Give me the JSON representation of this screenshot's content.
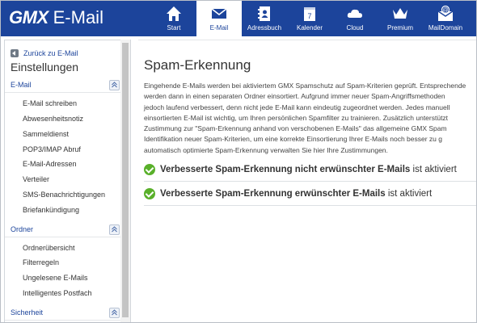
{
  "brand": {
    "logo": "GMX",
    "product": "E-Mail"
  },
  "nav": [
    {
      "label": "Start",
      "icon": "home-icon",
      "active": false
    },
    {
      "label": "E-Mail",
      "icon": "envelope-icon",
      "active": true
    },
    {
      "label": "Adressbuch",
      "icon": "addressbook-icon",
      "active": false
    },
    {
      "label": "Kalender",
      "icon": "calendar-icon",
      "active": false,
      "badge": "7"
    },
    {
      "label": "Cloud",
      "icon": "cloud-icon",
      "active": false
    },
    {
      "label": "Premium",
      "icon": "crown-icon",
      "active": false
    },
    {
      "label": "MailDomain",
      "icon": "maildomain-icon",
      "active": false
    }
  ],
  "sidebar": {
    "back_label": "Zurück zu E-Mail",
    "title": "Einstellungen",
    "sections": [
      {
        "title": "E-Mail",
        "items": [
          "E-Mail schreiben",
          "Abwesenheitsnotiz",
          "Sammeldienst",
          "POP3/IMAP Abruf",
          "E-Mail-Adressen",
          "Verteiler",
          "SMS-Benachrichtigungen",
          "Briefankündigung"
        ]
      },
      {
        "title": "Ordner",
        "items": [
          "Ordnerübersicht",
          "Filterregeln",
          "Ungelesene E-Mails",
          "Intelligentes Postfach"
        ]
      },
      {
        "title": "Sicherheit",
        "items": []
      }
    ]
  },
  "main": {
    "title": "Spam-Erkennung",
    "description_lines": [
      "Eingehende E-Mails werden bei aktiviertem GMX Spamschutz auf Spam-Kriterien geprüft. Entsprechende",
      "werden dann in einen separaten Ordner einsortiert. Aufgrund immer neuer Spam-Angriffsmethoden",
      "jedoch laufend verbessert, denn nicht jede E-Mail kann eindeutig zugeordnet werden. Jedes manuell",
      "einsortierten E-Mail ist wichtig, um Ihren persönlichen Spamfilter zu trainieren. Zusätzlich unterstützt",
      "Zustimmung zur \"Spam-Erkennung anhand von verschobenen E-Mails\" das allgemeine GMX Spam",
      "Identifikation neuer Spam-Kriterien, um eine korrekte Einsortierung Ihrer E-Mails noch besser zu g",
      "automatisch optimierte Spam-Erkennung verwalten Sie hier Ihre Zustimmungen."
    ],
    "statuses": [
      {
        "bold": "Verbesserte Spam-Erkennung nicht erwünschter E-Mails",
        "suffix": " ist aktiviert"
      },
      {
        "bold": "Verbesserte Spam-Erkennung erwünschter E-Mails",
        "suffix": " ist aktiviert"
      }
    ]
  },
  "colors": {
    "brand_blue": "#1c449b",
    "success_green": "#59b02a"
  }
}
